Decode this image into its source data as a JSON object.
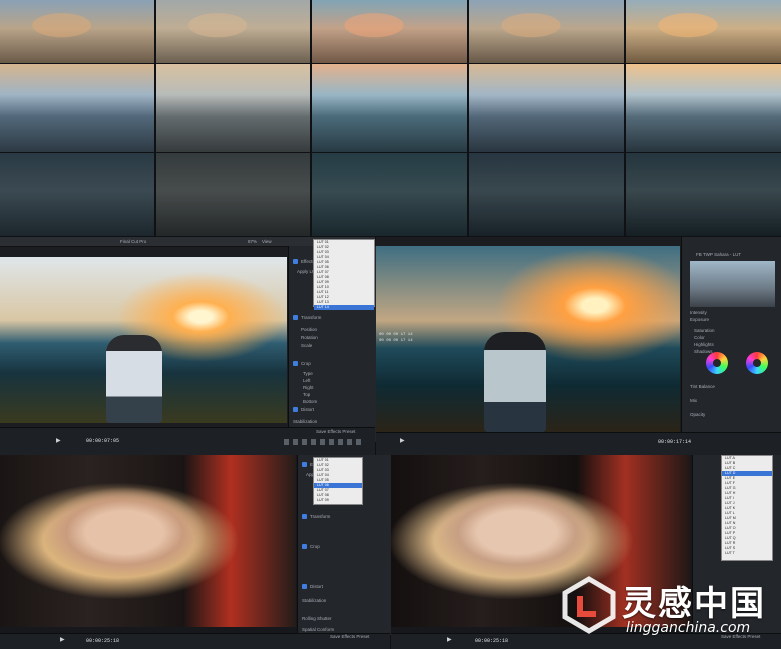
{
  "grade_grid": {
    "columns": 5,
    "rows": [
      "statue",
      "city",
      "bridge"
    ]
  },
  "top_left_window": {
    "title": "Final Cut Pro",
    "zoom": "87%",
    "view_label": "View",
    "inspector": {
      "effects_label": "Effects",
      "apply_lut_label": "Apply LUT",
      "transform_label": "Transform",
      "position_label": "Position",
      "rotation_label": "Rotation",
      "scale_label": "Scale",
      "crop_label": "Crop",
      "type_label": "Type",
      "left_label": "Left",
      "right_label": "Right",
      "top_label": "Top",
      "bottom_label": "Bottom",
      "distort_label": "Distort",
      "stabilization_label": "Stabilization",
      "rolling_shutter_label": "Rolling Shutter",
      "save_preset": "Save Effects Preset"
    },
    "lut_menu": [
      "LUT 01",
      "LUT 02",
      "LUT 03",
      "LUT 04",
      "LUT 05",
      "LUT 06",
      "LUT 07",
      "LUT 08",
      "LUT 09",
      "LUT 10",
      "LUT 11",
      "LUT 12",
      "LUT 13",
      "LUT 14"
    ],
    "lut_selected_index": 13,
    "timecode": "00:00:07:05"
  },
  "top_right_window": {
    "lut_name": "FB TWP Sahara - LUT",
    "timecode": "00:00:17:14",
    "overlay_tc": [
      "00 00 00 17 14",
      "00 00 00 17 14"
    ],
    "labels": [
      "Intensity",
      "Exposure",
      "Saturation",
      "Color",
      "Highlights",
      "Shadows",
      "Midtones",
      "Tint Balance",
      "Mix",
      "Color Wheel",
      "Opacity"
    ]
  },
  "bottom_left_window": {
    "effects_label": "Effects",
    "apply_lut_label": "Apply LUT",
    "transform_label": "Transform",
    "crop_label": "Crop",
    "distort_label": "Distort",
    "stabilization_label": "Stabilization",
    "rolling_shutter_label": "Rolling Shutter",
    "spatial_conform_label": "Spatial Conform",
    "save_preset": "Save Effects Preset",
    "timecode": "00:00:25:18"
  },
  "bottom_right_window": {
    "lut_menu": [
      "LUT A",
      "LUT B",
      "LUT C",
      "LUT D",
      "LUT E",
      "LUT F",
      "LUT G",
      "LUT H",
      "LUT I",
      "LUT J",
      "LUT K",
      "LUT L",
      "LUT M",
      "LUT N",
      "LUT O",
      "LUT P",
      "LUT Q",
      "LUT R",
      "LUT S",
      "LUT T"
    ],
    "lut_selected_index": 3,
    "timecode": "00:00:25:18",
    "save_preset": "Save Effects Preset"
  },
  "watermark": {
    "chinese": "灵感中国",
    "url": "lingganchina.com"
  },
  "colors": {
    "accent": "#3a75d6",
    "panel": "#23262b",
    "toolbar": "#2b2e33"
  }
}
